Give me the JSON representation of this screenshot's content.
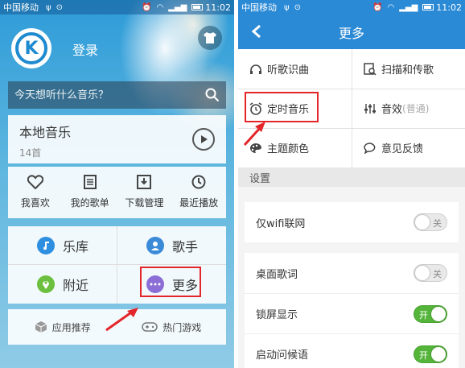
{
  "left_screen": {
    "status_bar": {
      "carrier": "中国移动",
      "time": "11:02"
    },
    "login_label": "登录",
    "search": {
      "placeholder": "今天想听什么音乐？"
    },
    "local_music": {
      "title": "本地音乐",
      "count": "14首"
    },
    "quick_links": [
      {
        "label": "我喜欢",
        "icon": "heart-icon"
      },
      {
        "label": "我的歌单",
        "icon": "playlist-icon"
      },
      {
        "label": "下载管理",
        "icon": "download-icon"
      },
      {
        "label": "最近播放",
        "icon": "clock-icon"
      }
    ],
    "grid": [
      {
        "label": "乐库",
        "icon": "music-note-icon",
        "color": "#2e8ee0"
      },
      {
        "label": "歌手",
        "icon": "singer-icon",
        "color": "#3a8ad8"
      },
      {
        "label": "附近",
        "icon": "location-icon",
        "color": "#6cbf3f"
      },
      {
        "label": "更多",
        "icon": "more-icon",
        "color": "#8b6fd6"
      }
    ],
    "bottom": [
      {
        "label": "应用推荐",
        "icon": "cube-icon"
      },
      {
        "label": "热门游戏",
        "icon": "gamepad-icon"
      }
    ]
  },
  "right_screen": {
    "status_bar": {
      "carrier": "中国移动",
      "time": "11:02"
    },
    "title": "更多",
    "features": [
      {
        "label": "听歌识曲",
        "icon": "headphones-icon"
      },
      {
        "label": "扫描和传歌",
        "icon": "scan-icon"
      },
      {
        "label": "定时音乐",
        "icon": "alarm-clock-icon"
      },
      {
        "label": "音效",
        "suffix": "(普通)",
        "icon": "equalizer-icon"
      },
      {
        "label": "主题颜色",
        "icon": "palette-icon"
      },
      {
        "label": "意见反馈",
        "icon": "feedback-icon"
      }
    ],
    "section_title": "设置",
    "settings": [
      {
        "label": "仅wifi联网",
        "state": "关",
        "on": false
      },
      {
        "label": "桌面歌词",
        "state": "关",
        "on": false
      },
      {
        "label": "锁屏显示",
        "state": "开",
        "on": true
      },
      {
        "label": "启动问候语",
        "state": "开",
        "on": true
      }
    ]
  },
  "colors": {
    "accent": "#2b8ad6",
    "highlight": "#e3262a",
    "toggle_on": "#55b53b"
  }
}
